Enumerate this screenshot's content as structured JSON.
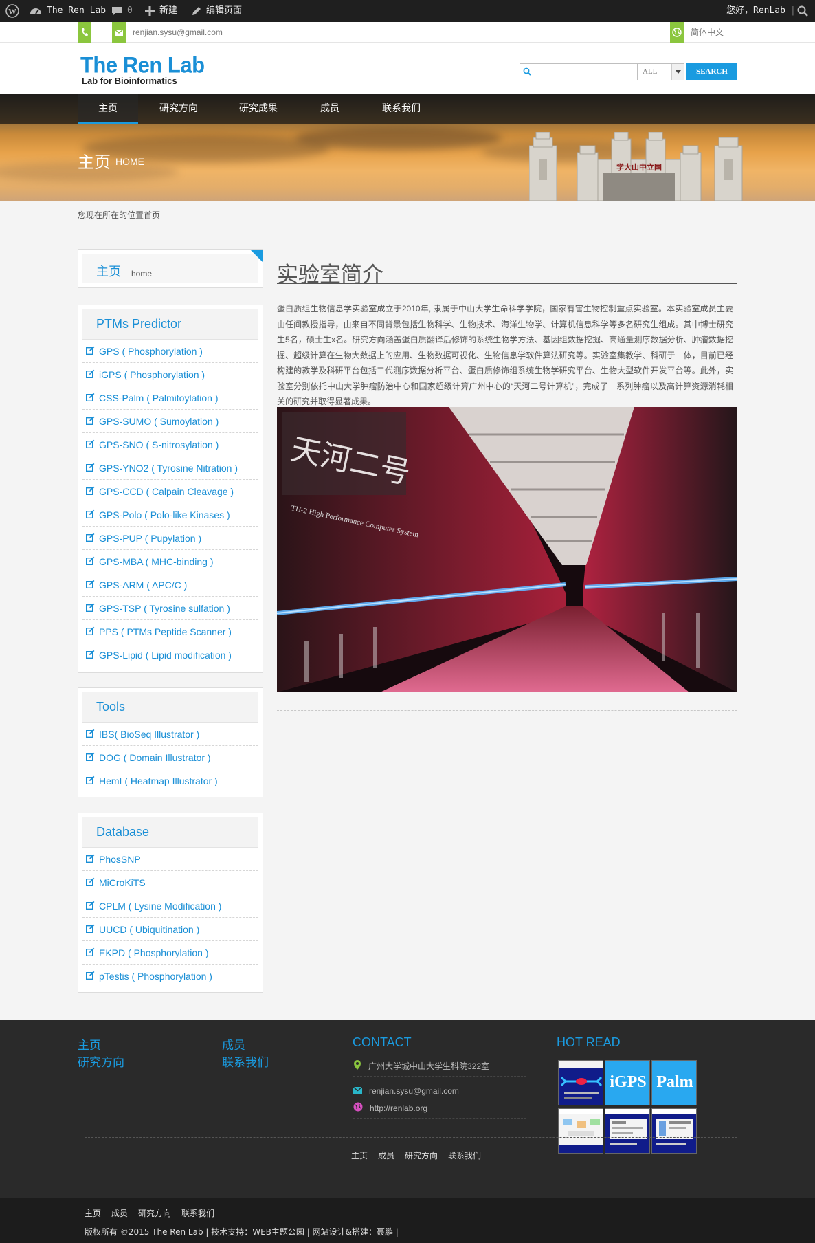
{
  "adminbar": {
    "site_name": "The Ren Lab",
    "comments_count": "0",
    "new_label": "新建",
    "edit_label": "编辑页面",
    "greeting": "您好，RenLab"
  },
  "contactbar": {
    "email": "renjian.sysu@gmail.com",
    "language": "简体中文"
  },
  "header": {
    "logo_title": "The Ren Lab",
    "logo_subtitle": "Lab for Bioinformatics",
    "search_placeholder": "",
    "search_scope": "ALL",
    "search_button": "SEARCH"
  },
  "nav": {
    "items": [
      "主页",
      "研究方向",
      "研究成果",
      "成员",
      "联系我们"
    ]
  },
  "banner": {
    "title": "主页",
    "subtitle": "HOME",
    "gate_text": "学大山中立国"
  },
  "breadcrumb": {
    "prefix": "您现在所在的位置",
    "current": "首页"
  },
  "sidebar": {
    "home_widget": {
      "title": "主页",
      "subtitle": "home"
    },
    "ptms": {
      "title": "PTMs Predictor",
      "items": [
        "GPS ( Phosphorylation )",
        "iGPS ( Phosphorylation )",
        "CSS-Palm ( Palmitoylation )",
        "GPS-SUMO ( Sumoylation )",
        "GPS-SNO ( S-nitrosylation )",
        "GPS-YNO2 ( Tyrosine Nitration )",
        "GPS-CCD ( Calpain Cleavage )",
        "GPS-Polo ( Polo-like Kinases )",
        "GPS-PUP ( Pupylation )",
        "GPS-MBA ( MHC-binding )",
        "GPS-ARM ( APC/C )",
        "GPS-TSP ( Tyrosine sulfation )",
        "PPS ( PTMs Peptide Scanner )",
        "GPS-Lipid ( Lipid modification )"
      ]
    },
    "tools": {
      "title": "Tools",
      "items": [
        "IBS( BioSeq Illustrator )",
        "DOG ( Domain Illustrator )",
        "HemI ( Heatmap Illustrator )"
      ]
    },
    "database": {
      "title": "Database",
      "items": [
        "PhosSNP",
        "MiCroKiTS",
        "CPLM ( Lysine Modification )",
        "UUCD ( Ubiquitination )",
        "EKPD ( Phosphorylation )",
        "pTestis ( Phosphorylation )"
      ]
    }
  },
  "main": {
    "title": "实验室简介",
    "body": "蛋白质组生物信息学实验室成立于2010年, 隶属于中山大学生命科学学院，国家有害生物控制重点实验室。本实验室成员主要由任间教授指导，由来自不同背景包括生物科学、生物技术、海洋生物学、计算机信息科学等多名研究生组成。其中博士研究生5名，硕士生x名。研究方向涵盖蛋白质翻译后修饰的系统生物学方法、基因组数据挖掘、高通量测序数据分析、肿瘤数据挖掘、超级计算在生物大数据上的应用、生物数据可视化、生物信息学软件算法研究等。实验室集教学、科研于一体，目前已经构建的教学及科研平台包括二代测序数据分析平台、蛋白质修饰组系统生物学研究平台、生物大型软件开发平台等。此外，实验室分别依托中山大学肿瘤防治中心和国家超级计算广州中心的“天河二号计算机”，完成了一系列肿瘤以及高计算资源消耗相关的研究并取得显著成果。",
    "photo_sign": "天河二号",
    "photo_caption": "TH-2 High Performance Computer System"
  },
  "footer": {
    "links_col1": [
      "主页",
      "研究方向"
    ],
    "links_col2": [
      "成员",
      "联系我们"
    ],
    "contact_title": "CONTACT",
    "address": "广州大学城中山大学生科院322室",
    "email": "renjian.sysu@gmail.com",
    "website": "http://renlab.org",
    "hot_title": "HOT READ",
    "hot_labels": [
      "iGPS",
      "Palm"
    ],
    "nav": [
      "主页",
      "成员",
      "研究方向",
      "联系我们"
    ]
  },
  "bottombar": {
    "nav": [
      "主页",
      "成员",
      "研究方向",
      "联系我们"
    ],
    "copyright": "版权所有 ©2015 The Ren Lab | 技术支持：WEB主题公园 | 网站设计&搭建：聂鹏 |"
  },
  "colors": {
    "accent": "#1a9be0",
    "green": "#8bc63e",
    "adminbar": "#1f1f1f",
    "footer": "#2a2a2a"
  },
  "icons": {
    "admin": [
      "wordpress-icon",
      "dashboard-icon",
      "comment-icon",
      "plus-icon",
      "pencil-icon",
      "search-icon"
    ],
    "contact": [
      "phone-icon",
      "mail-icon",
      "globe-icon"
    ],
    "list": "edit-square-icon",
    "footer": [
      "map-pin-icon",
      "mail-icon",
      "globe-icon"
    ]
  }
}
